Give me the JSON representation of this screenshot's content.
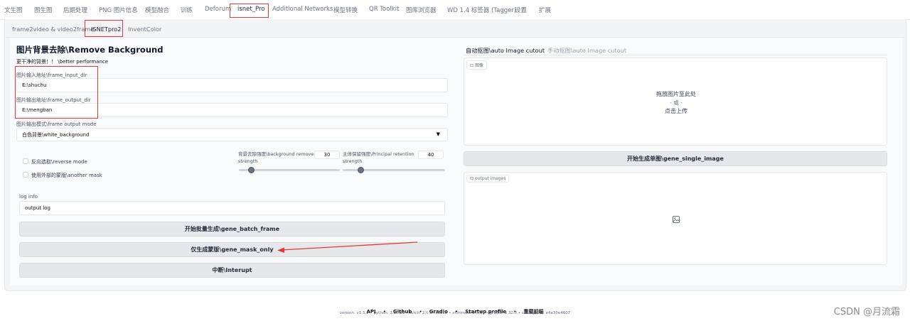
{
  "top_tabs": [
    "文生图",
    "图生图",
    "后期处理",
    "PNG 图片信息",
    "模型融合",
    "训练",
    "Deforum",
    "isnet_Pro",
    "Additional Networks",
    "模型转换",
    "QR Toolkit",
    "图库浏览器",
    "WD 1.4 标签器 (Tagger)",
    "设置",
    "扩展"
  ],
  "sub_tabs": [
    "frame2video & video2frame",
    "ISNETpro2",
    "InventColor"
  ],
  "left": {
    "title": "图片背景去除\\Remove Background",
    "subtitle": "更干净的背景！！ \\better performance",
    "input_dir_label": "图片输入地址\\frame_input_dir",
    "input_dir_value": "E:\\shuchu",
    "output_dir_label": "图片输出地址\\frame_output_dir",
    "output_dir_value": "E:\\mengban",
    "output_mode_label": "图片输出模式\\frame output mode",
    "output_mode_value": "白色背景\\white_background",
    "reverse_label": "反向选取\\reverse mode",
    "another_mask_label": "使用外部的蒙版\\another mask",
    "bg_strength_label": "背景去除强度\\background remove strength",
    "bg_strength_value": "30",
    "principal_label": "主体保留强度\\Principal retention strength",
    "principal_value": "40",
    "log_label": "log info",
    "log_value": "output log",
    "btn_batch": "开始批量生成\\gene_batch_frame",
    "btn_mask": "仅生成蒙版\\gene_mask_only",
    "btn_interrupt": "中断\\Interupt"
  },
  "right": {
    "tab_auto": "自动抠图\\auto Image cutout",
    "tab_manual": "手动抠图\\auto Image cutout",
    "image_label": "图像",
    "drop_text": "拖放图片至此处",
    "or_text": "- 或 -",
    "upload_text": "点击上传",
    "btn_single": "开始生成单图\\gene_single_image",
    "output_label": "output images"
  },
  "footer": {
    "links": [
      "API",
      "Github",
      "Gradio",
      "Startup profile",
      "重载前端"
    ],
    "version": "version: v1.5.2  •  python: 3.10.11  •  torch: 2.0.0+cu118  •  xformers: 0.0.17  •  gradio: 3.32.0  •  checkpoint: e4a30e4607"
  },
  "watermark": "CSDN @月流霜",
  "colors": {
    "annotation_red": "#e53935"
  }
}
